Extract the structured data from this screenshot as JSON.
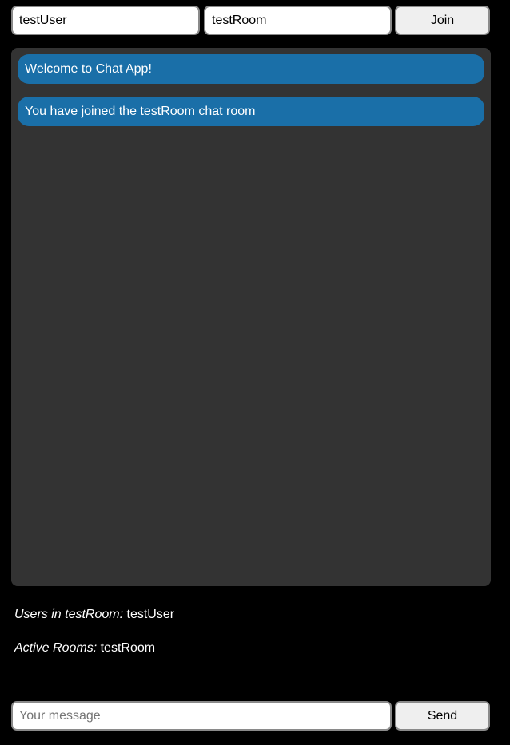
{
  "join_bar": {
    "username_value": "testUser",
    "room_value": "testRoom",
    "join_label": "Join"
  },
  "chat": {
    "messages": [
      {
        "text": "Welcome to Chat App!"
      },
      {
        "text": "You have joined the testRoom chat room"
      }
    ],
    "message_color": "#1a6fa8",
    "panel_color": "#333333"
  },
  "info": {
    "users_label": "Users in testRoom:",
    "users_value": "testUser",
    "rooms_label": "Active Rooms:",
    "rooms_value": "testRoom"
  },
  "send_bar": {
    "message_placeholder": "Your message",
    "message_value": "",
    "send_label": "Send"
  }
}
